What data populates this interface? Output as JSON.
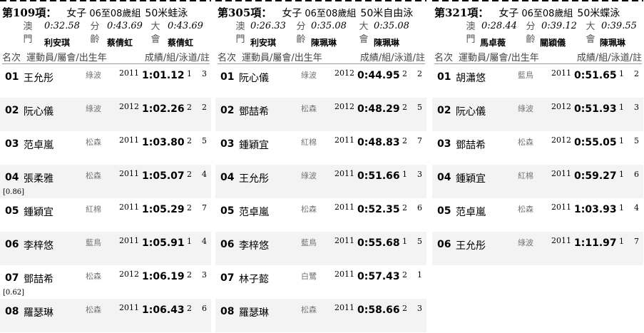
{
  "events": [
    {
      "no": "第109項：",
      "gender": "女子",
      "age": "06至08歲組",
      "style": "50米蛙泳",
      "records": [
        {
          "cat": "澳門",
          "time": "0:32.58",
          "holder": "利安琪"
        },
        {
          "cat": "分齡",
          "time": "0:43.69",
          "holder": "蔡倩虹"
        },
        {
          "cat": "大會",
          "time": "0:43.69",
          "holder": "蔡倩虹"
        }
      ],
      "columns": {
        "rank": "名次",
        "athlete": "運動員/屬會/出生年",
        "result": "成績/組/泳道/註"
      },
      "rows": [
        {
          "rank": "01",
          "name": "王允彤",
          "club": "綠波",
          "year": "2011",
          "time": "1:01.12",
          "group": "1",
          "lane": "3",
          "note": ""
        },
        {
          "rank": "02",
          "name": "阮心儀",
          "club": "綠波",
          "year": "2012",
          "time": "1:02.26",
          "group": "2",
          "lane": "2",
          "note": ""
        },
        {
          "rank": "03",
          "name": "范卓嵐",
          "club": "松森",
          "year": "2011",
          "time": "1:03.80",
          "group": "2",
          "lane": "5",
          "note": ""
        },
        {
          "rank": "04",
          "name": "張柔雅",
          "club": "松森",
          "year": "2011",
          "time": "1:05.07",
          "group": "2",
          "lane": "4",
          "note": "[0.86]"
        },
        {
          "rank": "05",
          "name": "鍾穎宜",
          "club": "紅棉",
          "year": "2011",
          "time": "1:05.29",
          "group": "2",
          "lane": "7",
          "note": ""
        },
        {
          "rank": "06",
          "name": "李梓悠",
          "club": "藍鳥",
          "year": "2011",
          "time": "1:05.91",
          "group": "1",
          "lane": "4",
          "note": ""
        },
        {
          "rank": "07",
          "name": "鄧喆希",
          "club": "松森",
          "year": "2012",
          "time": "1:06.19",
          "group": "2",
          "lane": "3",
          "note": "[0.62]"
        },
        {
          "rank": "08",
          "name": "羅瑟琳",
          "club": "松森",
          "year": "2011",
          "time": "1:06.43",
          "group": "2",
          "lane": "6",
          "note": ""
        }
      ]
    },
    {
      "no": "第305項：",
      "gender": "女子",
      "age": "06至08歲組",
      "style": "50米自由泳",
      "records": [
        {
          "cat": "澳門",
          "time": "0:26.33",
          "holder": "利安琪"
        },
        {
          "cat": "分齡",
          "time": "0:35.08",
          "holder": "陳珮琳"
        },
        {
          "cat": "大會",
          "time": "0:35.08",
          "holder": "陳珮琳"
        }
      ],
      "columns": {
        "rank": "名次",
        "athlete": "運動員/屬會/出生年",
        "result": "成績/組/泳道/註"
      },
      "rows": [
        {
          "rank": "01",
          "name": "阮心儀",
          "club": "綠波",
          "year": "2012",
          "time": "0:44.95",
          "group": "2",
          "lane": "2",
          "note": ""
        },
        {
          "rank": "02",
          "name": "鄧喆希",
          "club": "松森",
          "year": "2012",
          "time": "0:48.29",
          "group": "2",
          "lane": "5",
          "note": ""
        },
        {
          "rank": "03",
          "name": "鍾穎宜",
          "club": "紅棉",
          "year": "2011",
          "time": "0:48.83",
          "group": "2",
          "lane": "7",
          "note": ""
        },
        {
          "rank": "04",
          "name": "王允彤",
          "club": "綠波",
          "year": "2011",
          "time": "0:51.66",
          "group": "1",
          "lane": "3",
          "note": ""
        },
        {
          "rank": "05",
          "name": "范卓嵐",
          "club": "松森",
          "year": "2011",
          "time": "0:52.35",
          "group": "2",
          "lane": "6",
          "note": ""
        },
        {
          "rank": "06",
          "name": "李梓悠",
          "club": "藍鳥",
          "year": "2011",
          "time": "0:55.68",
          "group": "1",
          "lane": "5",
          "note": ""
        },
        {
          "rank": "07",
          "name": "林子懿",
          "club": "白鷺",
          "year": "2011",
          "time": "0:57.43",
          "group": "2",
          "lane": "1",
          "note": ""
        },
        {
          "rank": "08",
          "name": "羅瑟琳",
          "club": "松森",
          "year": "2011",
          "time": "0:58.66",
          "group": "2",
          "lane": "3",
          "note": ""
        }
      ]
    },
    {
      "no": "第321項：",
      "gender": "女子",
      "age": "06至08歲組",
      "style": "50米蝶泳",
      "records": [
        {
          "cat": "澳門",
          "time": "0:28.44",
          "holder": "馬卓薇"
        },
        {
          "cat": "分齡",
          "time": "0:39.12",
          "holder": "關穎儀"
        },
        {
          "cat": "大會",
          "time": "0:39.55",
          "holder": "陳珮琳"
        }
      ],
      "columns": {
        "rank": "名次",
        "athlete": "運動員/屬會/出生年",
        "result": "成績/組/泳道/註"
      },
      "rows": [
        {
          "rank": "01",
          "name": "胡瀟悠",
          "club": "藍鳥",
          "year": "2011",
          "time": "0:51.65",
          "group": "1",
          "lane": "2",
          "note": ""
        },
        {
          "rank": "02",
          "name": "阮心儀",
          "club": "綠波",
          "year": "2012",
          "time": "0:51.93",
          "group": "1",
          "lane": "3",
          "note": ""
        },
        {
          "rank": "03",
          "name": "鄧喆希",
          "club": "松森",
          "year": "2012",
          "time": "0:55.05",
          "group": "1",
          "lane": "5",
          "note": ""
        },
        {
          "rank": "04",
          "name": "鍾穎宜",
          "club": "紅棉",
          "year": "2011",
          "time": "0:59.27",
          "group": "1",
          "lane": "6",
          "note": ""
        },
        {
          "rank": "05",
          "name": "范卓嵐",
          "club": "松森",
          "year": "2011",
          "time": "1:03.93",
          "group": "1",
          "lane": "4",
          "note": ""
        },
        {
          "rank": "06",
          "name": "王允彤",
          "club": "綠波",
          "year": "2011",
          "time": "1:11.97",
          "group": "1",
          "lane": "7",
          "note": ""
        }
      ]
    }
  ]
}
